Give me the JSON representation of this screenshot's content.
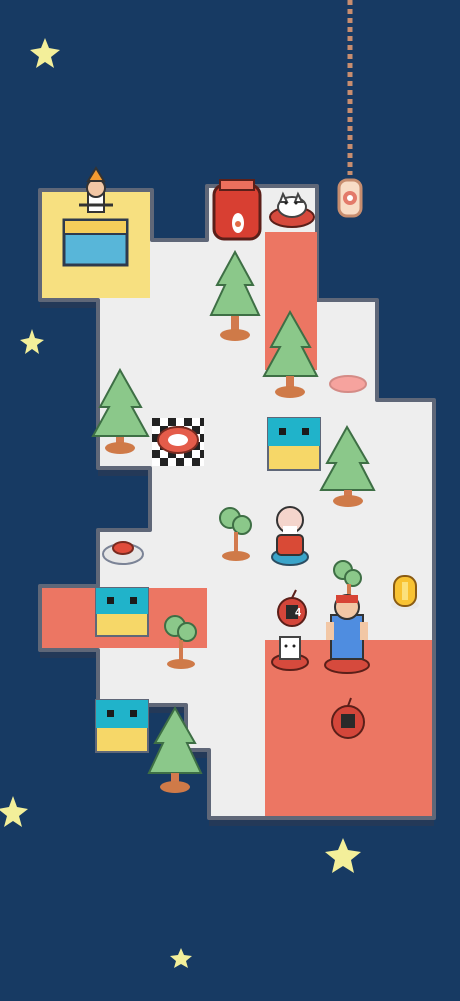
{
  "game": {
    "counter_value": "4"
  },
  "colors": {
    "background": "#173a63",
    "floor": "#eeeeee",
    "floor_shade": "#dcdcdc",
    "wall_outline": "#5f6778",
    "yellow_zone": "#f7e080",
    "red_zone": "#ec7663",
    "tree_green": "#8bc88a",
    "tree_trunk": "#d27a4e",
    "star": "#f3ef9a",
    "rope": "#c78d6f"
  },
  "pieces": {
    "counter_label": "4"
  }
}
